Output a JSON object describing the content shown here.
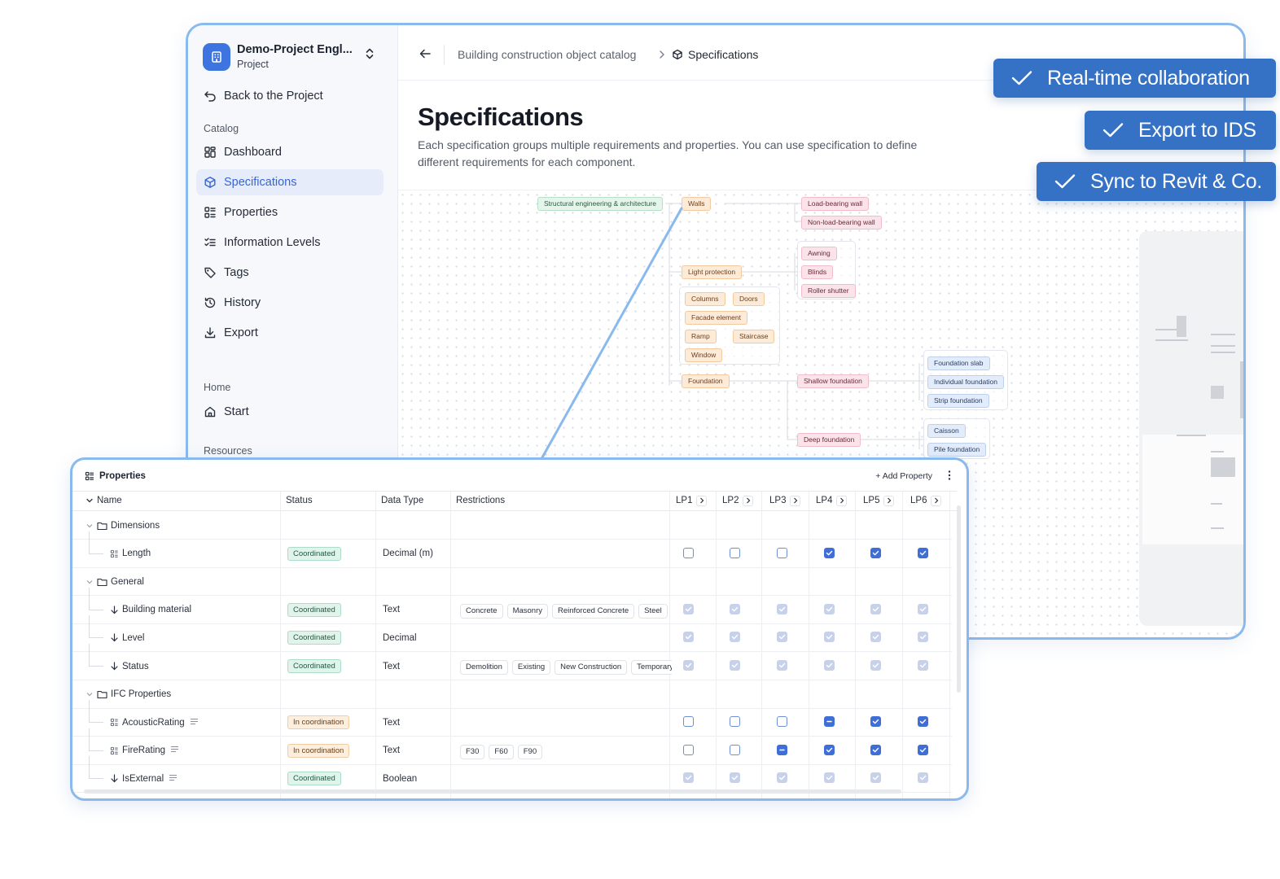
{
  "project": {
    "name": "Demo-Project Engl...",
    "sub": "Project"
  },
  "sidebar": {
    "back": "Back to the Project",
    "section_catalog": "Catalog",
    "items": [
      {
        "label": "Dashboard",
        "icon": "dashboard-icon"
      },
      {
        "label": "Specifications",
        "icon": "cube-icon"
      },
      {
        "label": "Properties",
        "icon": "properties-icon"
      },
      {
        "label": "Information Levels",
        "icon": "checklist-icon"
      },
      {
        "label": "Tags",
        "icon": "tag-icon"
      },
      {
        "label": "History",
        "icon": "history-icon"
      },
      {
        "label": "Export",
        "icon": "download-icon"
      }
    ],
    "section_home": "Home",
    "start": "Start",
    "section_resources": "Resources"
  },
  "breadcrumb": {
    "parent": "Building construction object catalog",
    "current": "Specifications"
  },
  "page": {
    "title": "Specifications",
    "description": "Each specification groups multiple requirements and properties. You can use specification to define different requirements for each component."
  },
  "graph": {
    "root": "Structural engineering & architecture",
    "walls": "Walls",
    "load_bearing": "Load-bearing wall",
    "non_load_bearing": "Non-load-bearing wall",
    "light_protection": "Light protection",
    "awning": "Awning",
    "blinds": "Blinds",
    "roller_shutter": "Roller shutter",
    "columns": "Columns",
    "doors": "Doors",
    "facade": "Facade element",
    "ramp": "Ramp",
    "staircase": "Staircase",
    "window": "Window",
    "foundation": "Foundation",
    "shallow": "Shallow foundation",
    "slab": "Foundation slab",
    "individual": "Individual foundation",
    "strip": "Strip foundation",
    "deep": "Deep foundation",
    "caisson": "Caisson",
    "pile": "Pile foundation"
  },
  "badges": [
    "Real-time collaboration",
    "Export to IDS",
    "Sync to Revit & Co."
  ],
  "colors": {
    "accent": "#3572c6",
    "frame": "#8ab9ee",
    "active_nav": "#3665d6"
  },
  "properties_panel": {
    "title": "Properties",
    "add_label": "+ Add Property",
    "columns": {
      "name": "Name",
      "status": "Status",
      "data_type": "Data Type",
      "restrictions": "Restrictions"
    },
    "levels": [
      "LP1",
      "LP2",
      "LP3",
      "LP4",
      "LP5",
      "LP6"
    ],
    "rows": [
      {
        "kind": "group",
        "name": "Dimensions"
      },
      {
        "kind": "prop",
        "icon": "property-icon",
        "name": "Length",
        "status": "Coordinated",
        "status_kind": "coord",
        "type": "Decimal (m)",
        "chips": [],
        "levels": [
          "off",
          "off",
          "off",
          "on",
          "on",
          "on"
        ]
      },
      {
        "kind": "group",
        "name": "General"
      },
      {
        "kind": "prop",
        "icon": "inherit-arrow-icon",
        "name": "Building material",
        "status": "Coordinated",
        "status_kind": "coord",
        "type": "Text",
        "chips": [
          "Concrete",
          "Masonry",
          "Reinforced Concrete",
          "Steel"
        ],
        "levels": [
          "dis",
          "dis",
          "dis",
          "dis",
          "dis",
          "dis"
        ]
      },
      {
        "kind": "prop",
        "icon": "inherit-arrow-icon",
        "name": "Level",
        "status": "Coordinated",
        "status_kind": "coord",
        "type": "Decimal",
        "chips": [],
        "levels": [
          "dis",
          "dis",
          "dis",
          "dis",
          "dis",
          "dis"
        ]
      },
      {
        "kind": "prop",
        "icon": "inherit-arrow-icon",
        "name": "Status",
        "status": "Coordinated",
        "status_kind": "coord",
        "type": "Text",
        "chips": [
          "Demolition",
          "Existing",
          "New Construction",
          "Temporary"
        ],
        "levels": [
          "dis",
          "dis",
          "dis",
          "dis",
          "dis",
          "dis"
        ]
      },
      {
        "kind": "group",
        "name": "IFC Properties"
      },
      {
        "kind": "prop",
        "icon": "property-icon",
        "name": "AcousticRating",
        "status": "In coordination",
        "status_kind": "incoord",
        "type": "Text",
        "chips": [],
        "levels": [
          "off",
          "off",
          "off",
          "mix",
          "on",
          "on"
        ],
        "lines_icon": true
      },
      {
        "kind": "prop",
        "icon": "property-icon",
        "name": "FireRating",
        "status": "In coordination",
        "status_kind": "incoord",
        "type": "Text",
        "chips": [
          "F30",
          "F60",
          "F90"
        ],
        "levels": [
          "off",
          "off",
          "mix",
          "on",
          "on",
          "on"
        ],
        "lines_icon": true
      },
      {
        "kind": "prop",
        "icon": "inherit-arrow-icon",
        "name": "IsExternal",
        "status": "Coordinated",
        "status_kind": "coord",
        "type": "Boolean",
        "chips": [],
        "levels": [
          "dis",
          "dis",
          "dis",
          "dis",
          "dis",
          "dis"
        ],
        "lines_icon": true
      }
    ]
  }
}
